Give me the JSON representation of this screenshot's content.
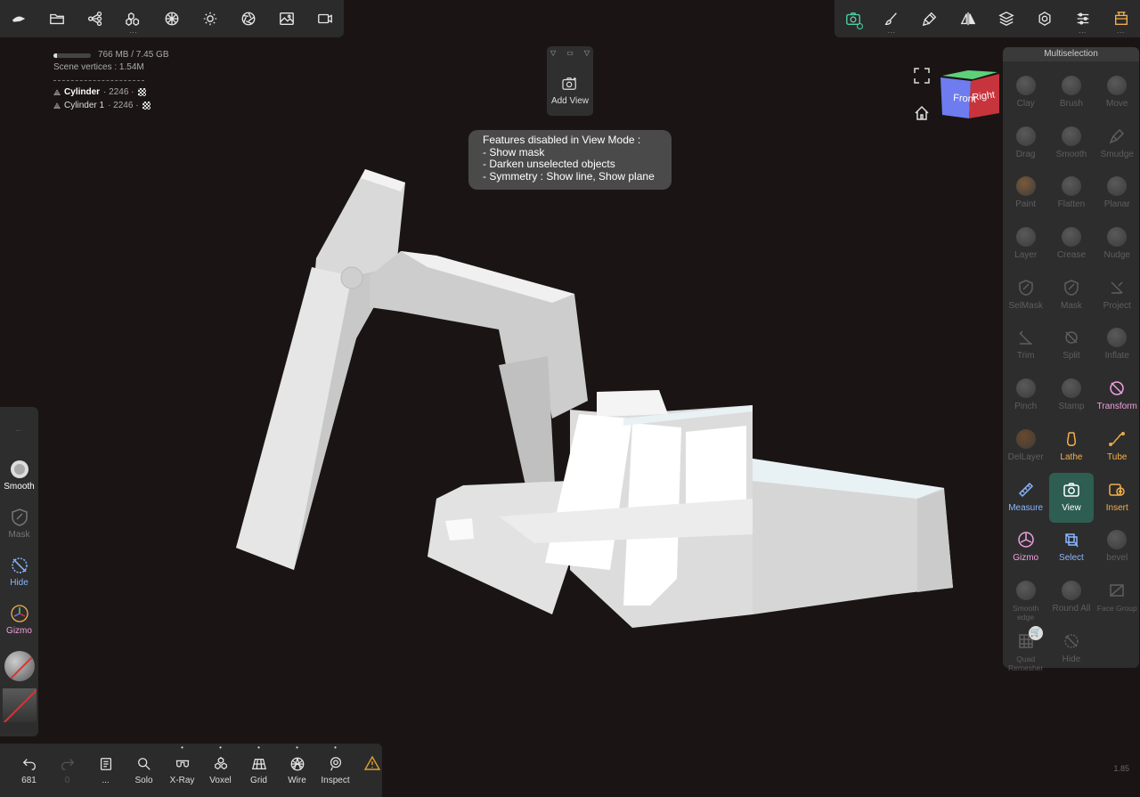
{
  "top_left_toolbar": {
    "icons": [
      "home-icon",
      "folder-icon",
      "scene-graph-icon",
      "multires-icon",
      "topology-icon",
      "lighting-icon",
      "shading-icon",
      "background-image-icon",
      "camera-icon"
    ]
  },
  "top_right_toolbar": {
    "icons": [
      "view-camera-icon",
      "brush-icon",
      "stroke-icon",
      "symmetry-icon",
      "layers-icon",
      "settings-icon",
      "sliders-icon",
      "interface-icon"
    ]
  },
  "stats": {
    "memory": "766 MB / 7.45 GB",
    "memory_fraction": 0.1,
    "scene_vertices": "Scene vertices : 1.54M",
    "objects": [
      {
        "name": "Cylinder",
        "count": "2246"
      },
      {
        "name": "Cylinder 1",
        "count": "2246"
      }
    ]
  },
  "add_view": {
    "label": "Add View"
  },
  "tooltip": {
    "line1": "Features disabled in View Mode :",
    "line2": "- Show mask",
    "line3": "- Darken unselected objects",
    "line4": "- Symmetry : Show line, Show plane"
  },
  "nav_cube": {
    "front": "Front",
    "right": "Right"
  },
  "right_panel": {
    "title": "Multiselection",
    "tools": [
      {
        "label": "Clay",
        "state": "disabled"
      },
      {
        "label": "Brush",
        "state": "disabled"
      },
      {
        "label": "Move",
        "state": "disabled"
      },
      {
        "label": "Drag",
        "state": "disabled"
      },
      {
        "label": "Smooth",
        "state": "disabled"
      },
      {
        "label": "Smudge",
        "state": "disabled"
      },
      {
        "label": "Paint",
        "state": "disabled"
      },
      {
        "label": "Flatten",
        "state": "disabled"
      },
      {
        "label": "Planar",
        "state": "disabled"
      },
      {
        "label": "Layer",
        "state": "disabled"
      },
      {
        "label": "Crease",
        "state": "disabled"
      },
      {
        "label": "Nudge",
        "state": "disabled"
      },
      {
        "label": "SelMask",
        "state": "disabled"
      },
      {
        "label": "Mask",
        "state": "disabled"
      },
      {
        "label": "Project",
        "state": "disabled"
      },
      {
        "label": "Trim",
        "state": "disabled"
      },
      {
        "label": "Split",
        "state": "disabled"
      },
      {
        "label": "Inflate",
        "state": "disabled"
      },
      {
        "label": "Pinch",
        "state": "disabled"
      },
      {
        "label": "Stamp",
        "state": "disabled"
      },
      {
        "label": "Transform",
        "state": "pink"
      },
      {
        "label": "DelLayer",
        "state": "disabled"
      },
      {
        "label": "Lathe",
        "state": "orange"
      },
      {
        "label": "Tube",
        "state": "orange"
      },
      {
        "label": "Measure",
        "state": "blue"
      },
      {
        "label": "View",
        "state": "selected"
      },
      {
        "label": "Insert",
        "state": "orange"
      },
      {
        "label": "Gizmo",
        "state": "pink"
      },
      {
        "label": "Select",
        "state": "blue"
      },
      {
        "label": "bevel",
        "state": "disabled"
      },
      {
        "label": "Smooth edge",
        "state": "disabled"
      },
      {
        "label": "Round All",
        "state": "disabled"
      },
      {
        "label": "Face Group",
        "state": "disabled"
      },
      {
        "label": "Quad Remesher",
        "state": "disabled"
      },
      {
        "label": "Hide",
        "state": "disabled"
      }
    ]
  },
  "left_bar": {
    "smooth": "Smooth",
    "mask": "Mask",
    "hide": "Hide",
    "gizmo": "Gizmo"
  },
  "bottom_bar": {
    "undo_count": "681",
    "redo_count": "0",
    "more_label": "...",
    "solo": "Solo",
    "xray": "X-Ray",
    "voxel": "Voxel",
    "grid": "Grid",
    "wire": "Wire",
    "inspect": "Inspect"
  },
  "version": "1.85"
}
